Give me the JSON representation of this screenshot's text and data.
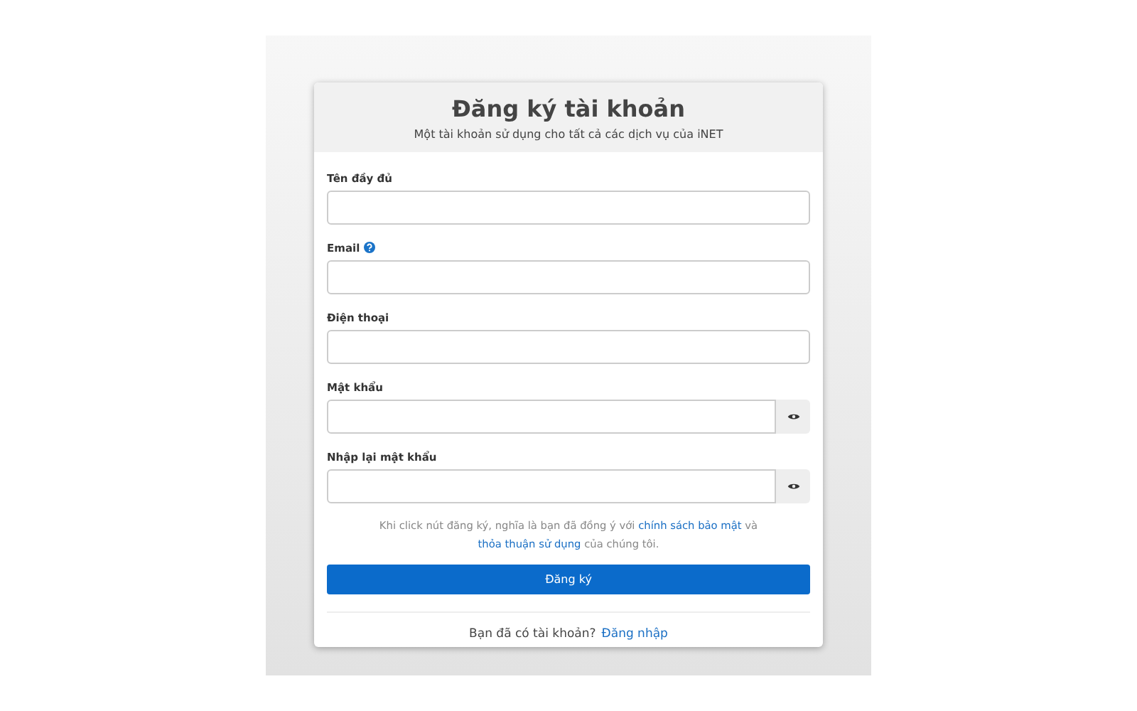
{
  "title": "Đăng ký tài khoản",
  "subtitle": "Một tài khoản sử dụng cho tất cả các dịch vụ của iNET",
  "fields": [
    {
      "label": "Tên đầy đủ",
      "kind": "text",
      "help": false
    },
    {
      "label": "Email",
      "kind": "text",
      "help": true
    },
    {
      "label": "Điện thoại",
      "kind": "text",
      "help": false
    },
    {
      "label": "Mật khẩu",
      "kind": "password",
      "help": false
    },
    {
      "label": "Nhập lại mật khẩu",
      "kind": "password",
      "help": false
    }
  ],
  "terms": [
    {
      "kind": "text",
      "text": "Khi click nút đăng ký, nghĩa là bạn đã đồng ý với "
    },
    {
      "kind": "link",
      "text": "chính sách bảo mật"
    },
    {
      "kind": "text",
      "text": " và "
    },
    {
      "kind": "link",
      "text": "thỏa thuận sử dụng"
    },
    {
      "kind": "text",
      "text": " của chúng tôi."
    }
  ],
  "submit": "Đăng ký",
  "login_prompt": "Bạn đã có tài khoản?",
  "login_link": "Đăng nhập"
}
